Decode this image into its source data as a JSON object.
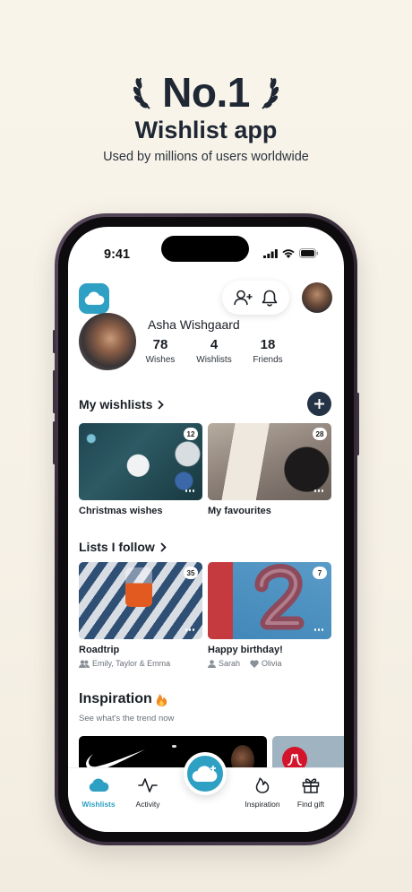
{
  "hero": {
    "title": "No.1",
    "subtitle": "Wishlist app",
    "tagline": "Used by millions of users worldwide"
  },
  "status_bar": {
    "time": "9:41"
  },
  "profile": {
    "name": "Asha Wishgaard",
    "stats": [
      {
        "value": "78",
        "label": "Wishes"
      },
      {
        "value": "4",
        "label": "Wishlists"
      },
      {
        "value": "18",
        "label": "Friends"
      }
    ]
  },
  "my_wishlists": {
    "heading": "My wishlists",
    "cards": [
      {
        "title": "Christmas wishes",
        "count": "12"
      },
      {
        "title": "My favourites",
        "count": "28"
      }
    ]
  },
  "lists_follow": {
    "heading": "Lists I follow",
    "cards": [
      {
        "title": "Roadtrip",
        "count": "35",
        "members": "Emily, Taylor & Emma"
      },
      {
        "title": "Happy birthday!",
        "count": "7",
        "member_a": "Sarah",
        "member_b": "Olivia"
      }
    ]
  },
  "inspiration": {
    "title": "Inspiration",
    "subtitle": "See what's the trend now"
  },
  "tabbar": {
    "wishlists": "Wishlists",
    "activity": "Activity",
    "inspiration": "Inspiration",
    "find_gift": "Find gift"
  },
  "colors": {
    "accent": "#2ea0c4",
    "navy": "#243345",
    "background": "#f6f1e6"
  },
  "icons": [
    "laurel-icon",
    "cloud-icon",
    "add-friend-icon",
    "bell-icon",
    "chevron-right-icon",
    "plus-icon",
    "more-icon",
    "group-icon",
    "person-icon",
    "heart-icon",
    "fire-icon",
    "activity-icon",
    "gift-icon"
  ]
}
